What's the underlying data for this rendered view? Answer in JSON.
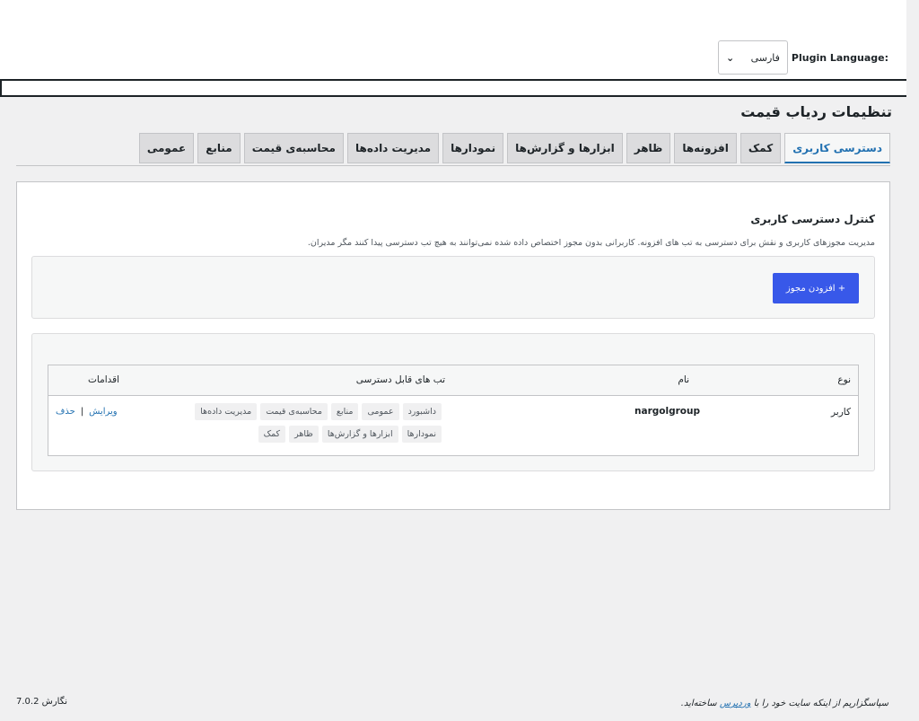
{
  "plugin_language": {
    "label": "Plugin Language:",
    "selected": "فارسی"
  },
  "page_title": "تنظیمات ردیاب قیمت",
  "tabs": [
    {
      "label": "عمومی",
      "active": false
    },
    {
      "label": "منابع",
      "active": false
    },
    {
      "label": "محاسبه‌ی قیمت",
      "active": false
    },
    {
      "label": "مدیریت داده‌ها",
      "active": false
    },
    {
      "label": "نمودارها",
      "active": false
    },
    {
      "label": "ابزارها و گزارش‌ها",
      "active": false
    },
    {
      "label": "ظاهر",
      "active": false
    },
    {
      "label": "افزونه‌ها",
      "active": false
    },
    {
      "label": "کمک",
      "active": false
    },
    {
      "label": "دسترسی کاربری",
      "active": true
    }
  ],
  "section": {
    "title": "کنترل دسترسی کاربری",
    "description": "مدیریت مجوزهای کاربری و نقش برای دسترسی به تب های افزونه. کاربرانی بدون مجوز اختصاص داده شده نمی‌توانند به هیچ تب دسترسی پیدا کنند مگر مدیران."
  },
  "add_button": "+ افزودن مجوز",
  "table": {
    "headers": {
      "type": "نوع",
      "name": "نام",
      "tabs": "تب های قابل دسترسی",
      "actions": "اقدامات"
    },
    "row": {
      "type": "کاربر",
      "name": "nargolgroup",
      "tabs": [
        "داشبورد",
        "عمومی",
        "منابع",
        "محاسبه‌ی قیمت",
        "مدیریت داده‌ها",
        "نمودارها",
        "ابزارها و گزارش‌ها",
        "ظاهر",
        "کمک"
      ],
      "edit": "ویرایش",
      "separator": "|",
      "delete": "حذف"
    }
  },
  "footer": {
    "version": "نگارش 7.0.2",
    "thanks_prefix": "سپاسگزاریم از اینکه سایت خود را با",
    "wordpress": "وردپرس",
    "thanks_suffix": "ساخته‌اید."
  },
  "colors": {
    "accent": "#2271b1",
    "button": "#3858e9"
  }
}
